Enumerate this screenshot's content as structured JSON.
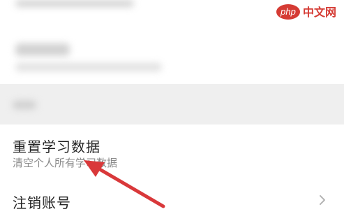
{
  "watermark": {
    "logo_text": "php",
    "site_text": "中文网"
  },
  "settings": {
    "reset_learning": {
      "title": "重置学习数据",
      "subtitle": "清空个人所有学习数据"
    },
    "cancel_account": {
      "title": "注销账号"
    }
  },
  "icons": {
    "chevron": "chevron-right-icon"
  },
  "colors": {
    "annotation_arrow": "#d9383a",
    "section_gap": "#efefef",
    "title_text": "#222222",
    "subtitle_text": "#8a8a8a"
  }
}
